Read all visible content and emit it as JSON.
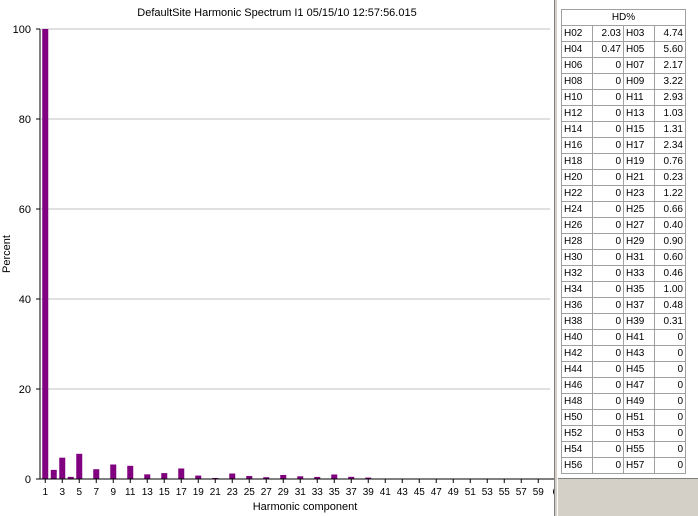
{
  "title": "DefaultSite  Harmonic Spectrum I1  05/15/10  12:57:56.015",
  "chart_data": {
    "type": "bar",
    "xlabel": "Harmonic component",
    "ylabel": "Percent",
    "ylim": [
      0,
      100
    ],
    "yticks": [
      0,
      20,
      40,
      60,
      80,
      100
    ],
    "grid": "horizontal",
    "bar_color": "#800080",
    "x_tick_labels": [
      "1",
      "3",
      "5",
      "7",
      "9",
      "11",
      "13",
      "15",
      "17",
      "19",
      "21",
      "23",
      "25",
      "27",
      "29",
      "31",
      "33",
      "35",
      "37",
      "39",
      "41",
      "43",
      "45",
      "47",
      "49",
      "51",
      "53",
      "55",
      "57",
      "59",
      "6"
    ],
    "harmonics": [
      1,
      2,
      3,
      4,
      5,
      6,
      7,
      8,
      9,
      10,
      11,
      12,
      13,
      14,
      15,
      16,
      17,
      18,
      19,
      20,
      21,
      22,
      23,
      24,
      25,
      26,
      27,
      28,
      29,
      30,
      31,
      32,
      33,
      34,
      35,
      36,
      37,
      38,
      39
    ],
    "values": [
      100,
      2.03,
      4.74,
      0.47,
      5.6,
      0,
      2.17,
      0,
      3.22,
      0,
      2.93,
      0,
      1.03,
      0,
      1.31,
      0,
      2.34,
      0,
      0.76,
      0,
      0.23,
      0,
      1.22,
      0,
      0.66,
      0,
      0.4,
      0,
      0.9,
      0,
      0.6,
      0,
      0.46,
      0,
      1.0,
      0,
      0.48,
      0,
      0.31
    ]
  },
  "table": {
    "header": "HD%",
    "rows": [
      [
        "H02",
        "2.03",
        "H03",
        "4.74"
      ],
      [
        "H04",
        "0.47",
        "H05",
        "5.60"
      ],
      [
        "H06",
        "0",
        "H07",
        "2.17"
      ],
      [
        "H08",
        "0",
        "H09",
        "3.22"
      ],
      [
        "H10",
        "0",
        "H11",
        "2.93"
      ],
      [
        "H12",
        "0",
        "H13",
        "1.03"
      ],
      [
        "H14",
        "0",
        "H15",
        "1.31"
      ],
      [
        "H16",
        "0",
        "H17",
        "2.34"
      ],
      [
        "H18",
        "0",
        "H19",
        "0.76"
      ],
      [
        "H20",
        "0",
        "H21",
        "0.23"
      ],
      [
        "H22",
        "0",
        "H23",
        "1.22"
      ],
      [
        "H24",
        "0",
        "H25",
        "0.66"
      ],
      [
        "H26",
        "0",
        "H27",
        "0.40"
      ],
      [
        "H28",
        "0",
        "H29",
        "0.90"
      ],
      [
        "H30",
        "0",
        "H31",
        "0.60"
      ],
      [
        "H32",
        "0",
        "H33",
        "0.46"
      ],
      [
        "H34",
        "0",
        "H35",
        "1.00"
      ],
      [
        "H36",
        "0",
        "H37",
        "0.48"
      ],
      [
        "H38",
        "0",
        "H39",
        "0.31"
      ],
      [
        "H40",
        "0",
        "H41",
        "0"
      ],
      [
        "H42",
        "0",
        "H43",
        "0"
      ],
      [
        "H44",
        "0",
        "H45",
        "0"
      ],
      [
        "H46",
        "0",
        "H47",
        "0"
      ],
      [
        "H48",
        "0",
        "H49",
        "0"
      ],
      [
        "H50",
        "0",
        "H51",
        "0"
      ],
      [
        "H52",
        "0",
        "H53",
        "0"
      ],
      [
        "H54",
        "0",
        "H55",
        "0"
      ],
      [
        "H56",
        "0",
        "H57",
        "0"
      ]
    ]
  }
}
